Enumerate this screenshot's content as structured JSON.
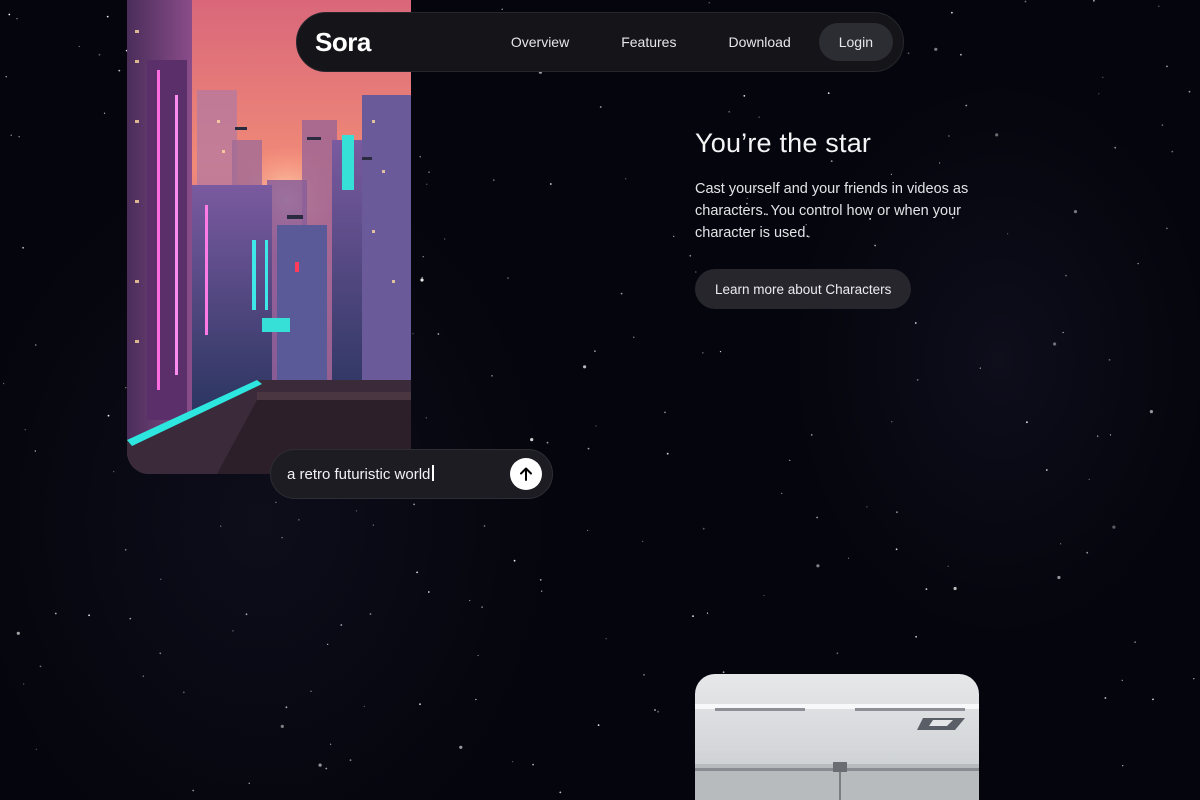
{
  "nav": {
    "logo": "Sora",
    "links": [
      "Overview",
      "Features",
      "Download"
    ],
    "login": "Login"
  },
  "hero": {
    "prompt_text": "a retro futuristic world",
    "send_icon": "arrow-up-icon"
  },
  "feature": {
    "title": "You’re the star",
    "description": "Cast yourself and your friends in videos as characters. You control how or when your character is used.",
    "cta": "Learn more about Characters"
  },
  "colors": {
    "background": "#05050d",
    "nav_bg": "#141419",
    "button_bg": "#26262c",
    "neon_pink": "#ff5fd2",
    "neon_cyan": "#37e6e6"
  }
}
